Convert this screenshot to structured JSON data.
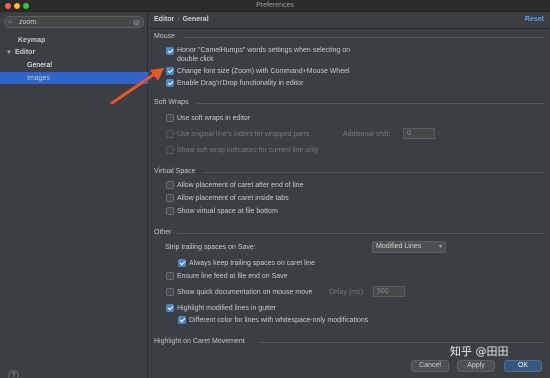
{
  "window": {
    "title": "Preferences"
  },
  "sidebar": {
    "search_value": "zoom",
    "items": [
      {
        "label": "Keymap"
      },
      {
        "label": "Editor"
      },
      {
        "label": "General"
      },
      {
        "label": "Images"
      }
    ],
    "selected": "General"
  },
  "header": {
    "crumb_root": "Editor",
    "crumb_sep": "›",
    "crumb_leaf": "General",
    "reset": "Reset"
  },
  "mouse": {
    "title": "Mouse",
    "items": [
      {
        "label": "Honor \"CamelHumps\" words settings when selecting on",
        "label2": "double click",
        "checked": true
      },
      {
        "label": "Change font size (Zoom) with Command+Mouse Wheel",
        "checked": true
      },
      {
        "label": "Enable Drag'n'Drop functionality in editor",
        "checked": true
      }
    ]
  },
  "soft_wraps": {
    "title": "Soft Wraps",
    "use_soft_wraps": "Use soft wraps in editor",
    "original_indent": "Use original line's indent for wrapped parts",
    "additional_shift_label": "Additional shift:",
    "additional_shift_value": "0",
    "show_indicators": "Show soft wrap indicators for current line only"
  },
  "virtual_space": {
    "title": "Virtual Space",
    "items": [
      {
        "label": "Allow placement of caret after end of line"
      },
      {
        "label": "Allow placement of caret inside tabs"
      },
      {
        "label": "Show virtual space at file bottom"
      }
    ]
  },
  "other": {
    "title": "Other",
    "strip_label": "Strip trailing spaces on Save:",
    "strip_value": "Modified Lines",
    "always_keep": "Always keep trailing spaces on caret line",
    "ensure_line_feed": "Ensure line feed at file end on Save",
    "quick_doc": "Show quick documentation on mouse move",
    "delay_label": "Delay (ms):",
    "delay_value": "500",
    "highlight_modified": "Highlight modified lines in gutter",
    "different_color": "Different color for lines with whitespace-only modifications"
  },
  "highlight_caret": {
    "title": "Highlight on Caret Movement"
  },
  "footer": {
    "help": "?",
    "cancel": "Cancel",
    "apply": "Apply",
    "ok": "OK"
  },
  "watermark": "知乎 @田田",
  "colors": {
    "accent": "#2f65ca",
    "checkbox": "#4a88c7",
    "link": "#589df6",
    "annotation_arrow": "#e8542f"
  }
}
